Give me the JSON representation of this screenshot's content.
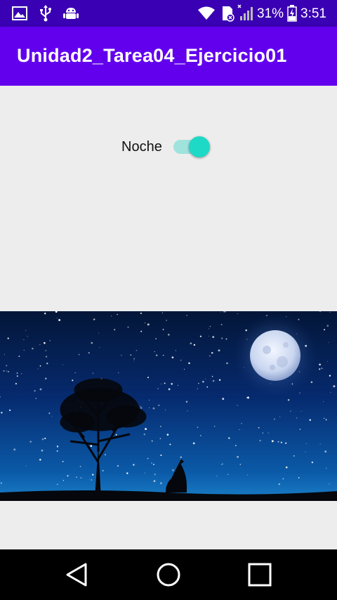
{
  "status_bar": {
    "battery_percent": "31%",
    "time": "3:51",
    "left_icons": [
      "image-icon",
      "usb-icon",
      "android-debug-icon"
    ],
    "right_icons": [
      "wifi-icon",
      "sim-card-icon",
      "signal-icon",
      "battery-icon"
    ]
  },
  "app_bar": {
    "title": "Unidad2_Tarea04_Ejercicio01",
    "color": "#6200ee"
  },
  "switch": {
    "label": "Noche",
    "checked": true,
    "accent_color": "#1ed9c6"
  },
  "image": {
    "icon": "night-sky-wolf-image"
  },
  "nav_bar": {
    "buttons": [
      "back-icon",
      "home-icon",
      "recents-icon"
    ]
  }
}
